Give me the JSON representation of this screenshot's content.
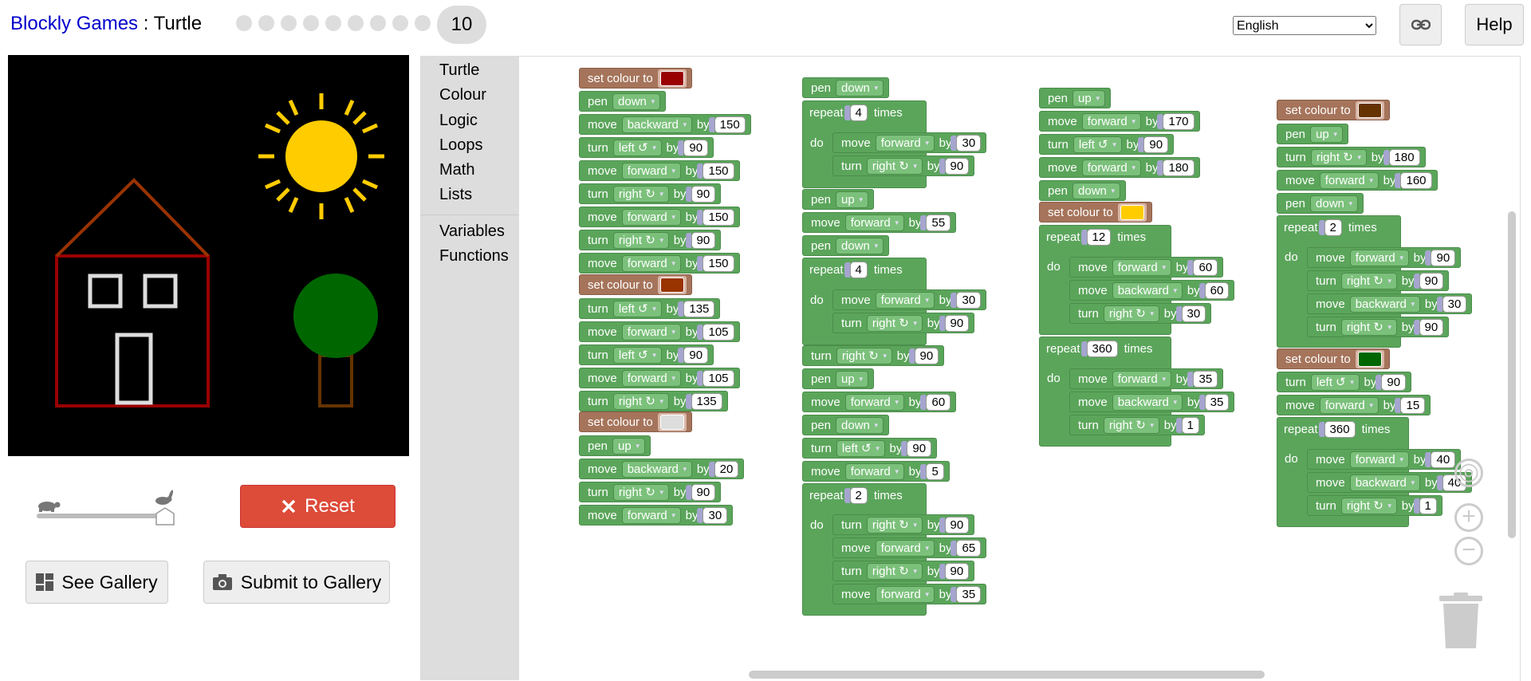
{
  "header": {
    "brand": "Blockly Games",
    "separator": " : ",
    "game": "Turtle",
    "level_dots": 9,
    "level": "10",
    "language": "English",
    "help": "Help"
  },
  "controls": {
    "reset": "Reset",
    "see_gallery": "See Gallery",
    "submit_gallery": "Submit to Gallery",
    "speed": 1.0
  },
  "toolbox": [
    "Turtle",
    "Colour",
    "Logic",
    "Loops",
    "Math",
    "Lists",
    "Variables",
    "Functions"
  ],
  "colors": {
    "dark_red": "#990000",
    "brown": "#993300",
    "light_gray": "#dddddd",
    "yellow": "#ffcc00",
    "dark_brown": "#663300",
    "green": "#006600"
  },
  "words": {
    "set_colour": "set colour to",
    "pen": "pen",
    "move": "move",
    "turn": "turn",
    "by": "by",
    "repeat": "repeat",
    "times": "times",
    "do": "do",
    "forward": "forward",
    "backward": "backward",
    "left": "left ↺",
    "right": "right ↻",
    "up": "up",
    "down": "down"
  },
  "values": {
    "c1": [
      "150",
      "90",
      "150",
      "90",
      "150",
      "90",
      "150",
      "135",
      "105",
      "90",
      "105",
      "135",
      "20",
      "90",
      "30"
    ],
    "c2": [
      "4",
      "30",
      "90",
      "55",
      "4",
      "30",
      "90",
      "90",
      "60",
      "90",
      "5",
      "2",
      "90",
      "65",
      "90",
      "35"
    ],
    "c3": [
      "170",
      "90",
      "180",
      "12",
      "60",
      "60",
      "30",
      "360",
      "35",
      "35",
      "1"
    ],
    "c4": [
      "180",
      "160",
      "2",
      "90",
      "90",
      "30",
      "90",
      "90",
      "15",
      "360",
      "40",
      "40",
      "1"
    ]
  }
}
